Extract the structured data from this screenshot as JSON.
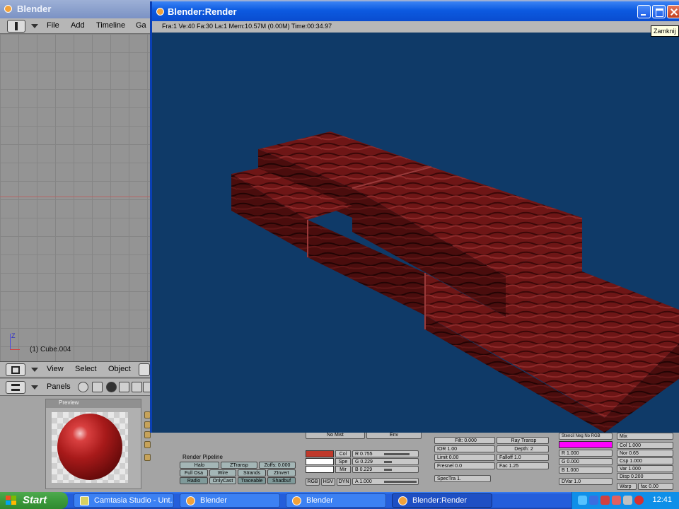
{
  "main_window": {
    "title": "Blender",
    "menu": [
      "File",
      "Add",
      "Timeline",
      "Ga"
    ],
    "object_label": "(1) Cube.004",
    "axis_label": "Z",
    "view_header": [
      "View",
      "Select",
      "Object"
    ],
    "buttons_header": "Panels",
    "preview_title": "Preview",
    "render_pipeline": {
      "title": "Render Pipeline",
      "buttons": [
        "Halo",
        "ZTransp",
        "Zoffs: 0.000",
        "Full Osa",
        "Wire",
        "Strands",
        "ZInvert",
        "Radio",
        "OnlyCast",
        "Traceable",
        "Shadbuf"
      ]
    },
    "material": {
      "top_buttons": [
        "No Mist",
        "Env"
      ],
      "swatch_labels": [
        "Col",
        "Spe",
        "Mir"
      ],
      "swatch_colors": [
        "#c0392b",
        "#ffffff",
        "#ffffff"
      ],
      "rgb_rows": [
        "R 0.755",
        "G 0.229",
        "B 0.229"
      ],
      "mode_buttons": [
        "RGB",
        "HSV",
        "DYN"
      ],
      "alpha": "A 1.000"
    },
    "shader": {
      "rows": [
        "Filt: 0.000",
        "Ray Transp",
        "IOR 1.00",
        "Depth: 2",
        "Limit 0.00",
        "Falloff 1.0",
        "Fresnel 0.0",
        "Fac 1.25",
        "SpecTra 1."
      ]
    },
    "texture": {
      "header": "Stencil Neg No RGB",
      "rows": [
        "R 1.000",
        "G 0.000",
        "B 1.000",
        "DVar 1.0"
      ],
      "color": "#ff00ff"
    },
    "mix": {
      "header": "Mix",
      "rows": [
        "Col 1.000",
        "Nor 0.65",
        "Csp 1.000",
        "Var 1.000",
        "Disp 0.200",
        "Warp",
        "fac 0.00"
      ]
    }
  },
  "render_window": {
    "title": "Blender:Render",
    "info": "Fra:1  Ve:40 Fa:30 La:1  Mem:10.57M (0.00M)  Time:00:34.97",
    "background": "#0f3a68",
    "brick_color": "#7a1a1a"
  },
  "tooltip": "Zamknij",
  "taskbar": {
    "start": "Start",
    "buttons": [
      {
        "label": "Camtasia Studio - Unt...",
        "icon": "camtasia-icon"
      },
      {
        "label": "Blender",
        "icon": "blender-icon"
      },
      {
        "label": "Blender",
        "icon": "blender-icon"
      },
      {
        "label": "Blender:Render",
        "icon": "blender-icon"
      }
    ],
    "clock": "12:41"
  }
}
